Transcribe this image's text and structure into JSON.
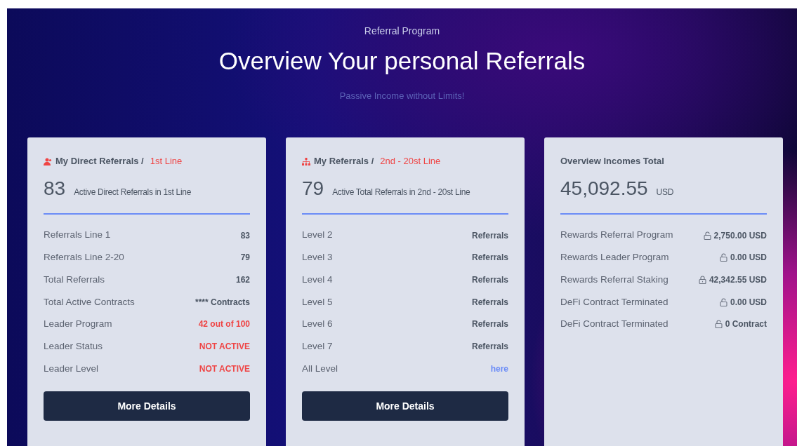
{
  "header": {
    "eyebrow": "Referral Program",
    "title": "Overview Your personal Referrals",
    "subtitle": "Passive Income without Limits!"
  },
  "cards": [
    {
      "kind": "direct",
      "title": "My Direct Referrals /",
      "accent": "1st Line",
      "big": "83",
      "big_label": "Active Direct Referrals in 1st Line",
      "rows": [
        {
          "label": "Referrals Line 1",
          "value": "83",
          "kind": "text"
        },
        {
          "label": "Referrals Line 2-20",
          "value": "79",
          "kind": "text"
        },
        {
          "label": "Total Referrals",
          "value": "162",
          "kind": "text"
        },
        {
          "label": "Total Active Contracts",
          "value": "**** Contracts",
          "kind": "text"
        },
        {
          "label": "Leader Program",
          "value": "42 out of 100",
          "kind": "alert"
        },
        {
          "label": "Leader Status",
          "value": "NOT ACTIVE",
          "kind": "alert"
        },
        {
          "label": "Leader Level",
          "value": "NOT ACTIVE",
          "kind": "alert"
        }
      ],
      "button": "More Details"
    },
    {
      "kind": "network",
      "title": "My Referrals /",
      "accent": "2nd - 20st Line",
      "big": "79",
      "big_label": "Active Total Referrals in 2nd - 20st Line",
      "rows": [
        {
          "label": "Level 2",
          "value": "Referrals",
          "kind": "text"
        },
        {
          "label": "Level 3",
          "value": "Referrals",
          "kind": "text"
        },
        {
          "label": "Level 4",
          "value": "Referrals",
          "kind": "text"
        },
        {
          "label": "Level 5",
          "value": "Referrals",
          "kind": "text"
        },
        {
          "label": "Level 6",
          "value": "Referrals",
          "kind": "text"
        },
        {
          "label": "Level 7",
          "value": "Referrals",
          "kind": "text"
        },
        {
          "label": "All Level",
          "value": "here",
          "kind": "link"
        }
      ],
      "button": "More Details"
    },
    {
      "kind": "plain",
      "title": "Overview Incomes Total",
      "big": "45,092.55",
      "big_label": "USD",
      "rows": [
        {
          "label": "Rewards Referral Program",
          "value": "2,750.00 USD",
          "kind": "lock",
          "locked": false
        },
        {
          "label": "Rewards Leader Program",
          "value": "0.00 USD",
          "kind": "lock",
          "locked": false
        },
        {
          "label": "Rewards Referral Staking",
          "value": "42,342.55 USD",
          "kind": "lock",
          "locked": true
        },
        {
          "label": "DeFi Contract Terminated",
          "value": "0.00 USD",
          "kind": "lock",
          "locked": false
        },
        {
          "label": "DeFi Contract Terminated",
          "value": "0 Contract",
          "kind": "lock",
          "locked": false
        }
      ]
    }
  ]
}
